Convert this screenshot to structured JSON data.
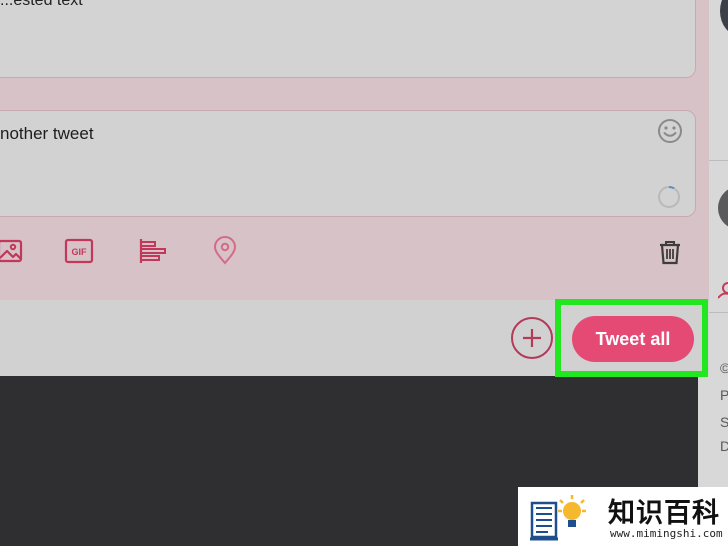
{
  "thread": {
    "first_tweet_text": "...ested text",
    "second_tweet_text": "nother tweet"
  },
  "toolbar": {
    "media_icon": "image-icon",
    "gif_icon": "gif-icon",
    "gif_label": "GIF",
    "poll_icon": "poll-icon",
    "location_icon": "location-icon",
    "delete_icon": "trash-icon"
  },
  "compose": {
    "emoji_icon": "emoji-icon",
    "progress_icon": "character-progress-icon"
  },
  "actions": {
    "add_tweet_icon": "plus-icon",
    "tweet_all_label": "Tweet all"
  },
  "sidebar": {
    "footer_lines": [
      "©",
      "P",
      "S",
      "D"
    ]
  },
  "watermark": {
    "title": "知识百科",
    "url": "www.mimingshi.com"
  },
  "colors": {
    "accent": "#e44a73",
    "icon_accent": "#c2385a",
    "highlight": "#22e61f"
  }
}
